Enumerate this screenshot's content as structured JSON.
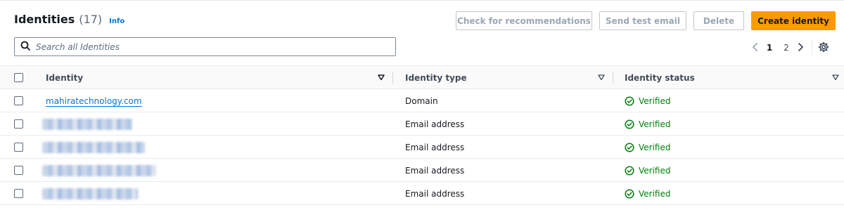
{
  "header": {
    "title": "Identities",
    "count": "(17)",
    "info_link": "Info"
  },
  "actions": {
    "check_recommendations": "Check for recommendations",
    "send_test_email": "Send test email",
    "delete": "Delete",
    "create_identity": "Create identity"
  },
  "search": {
    "placeholder": "Search all Identities",
    "value": ""
  },
  "pagination": {
    "pages": [
      "1",
      "2"
    ],
    "current": "1"
  },
  "table": {
    "columns": [
      "Identity",
      "Identity type",
      "Identity status"
    ],
    "rows": [
      {
        "identity": "mahiratechnology.com",
        "type": "Domain",
        "status": "Verified"
      },
      {
        "identity": "",
        "type": "Email address",
        "status": "Verified"
      },
      {
        "identity": "",
        "type": "Email address",
        "status": "Verified"
      },
      {
        "identity": "",
        "type": "Email address",
        "status": "Verified"
      },
      {
        "identity": "",
        "type": "Email address",
        "status": "Verified"
      }
    ]
  },
  "colors": {
    "primary": "#ff9900",
    "link": "#0972d3",
    "success": "#037f0c"
  }
}
